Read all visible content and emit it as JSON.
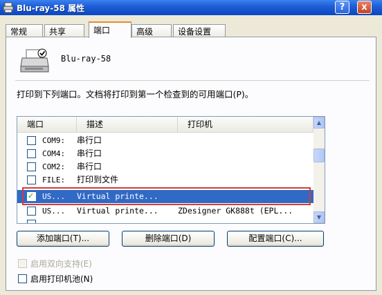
{
  "window": {
    "title": "Blu-ray-58 属性",
    "help_label": "?",
    "close_label": "x"
  },
  "tabs": [
    {
      "label": "常规"
    },
    {
      "label": "共享"
    },
    {
      "label": "端口"
    },
    {
      "label": "高级"
    },
    {
      "label": "设备设置"
    }
  ],
  "active_tab": "端口",
  "printer_name": "Blu-ray-58",
  "instruction": "打印到下列端口。文档将打印到第一个检查到的可用端口(P)。",
  "ports_table": {
    "columns": [
      "端口",
      "描述",
      "打印机"
    ],
    "rows": [
      {
        "port": "COM9:",
        "desc": "串行口",
        "printer": "",
        "checked": false
      },
      {
        "port": "COM4:",
        "desc": "串行口",
        "printer": "",
        "checked": false
      },
      {
        "port": "COM2:",
        "desc": "串行口",
        "printer": "",
        "checked": false
      },
      {
        "port": "FILE:",
        "desc": "打印到文件",
        "printer": "",
        "checked": false
      },
      {
        "port": "US...",
        "desc": "Virtual printe...",
        "printer": "",
        "checked": true,
        "selected": true
      },
      {
        "port": "US...",
        "desc": "Virtual printe...",
        "printer": "ZDesigner GK888t (EPL...",
        "checked": false
      }
    ]
  },
  "buttons": {
    "add_port": "添加端口(T)...",
    "delete_port": "删除端口(D)",
    "configure_port": "配置端口(C)..."
  },
  "options": {
    "bidirectional": "启用双向支持(E)",
    "pooling": "启用打印机池(N)"
  },
  "colors": {
    "title_bar": "#0a47c2",
    "selection": "#316ac5",
    "highlight_box": "#d43a3a",
    "active_tab_accent": "#e68b2c"
  }
}
